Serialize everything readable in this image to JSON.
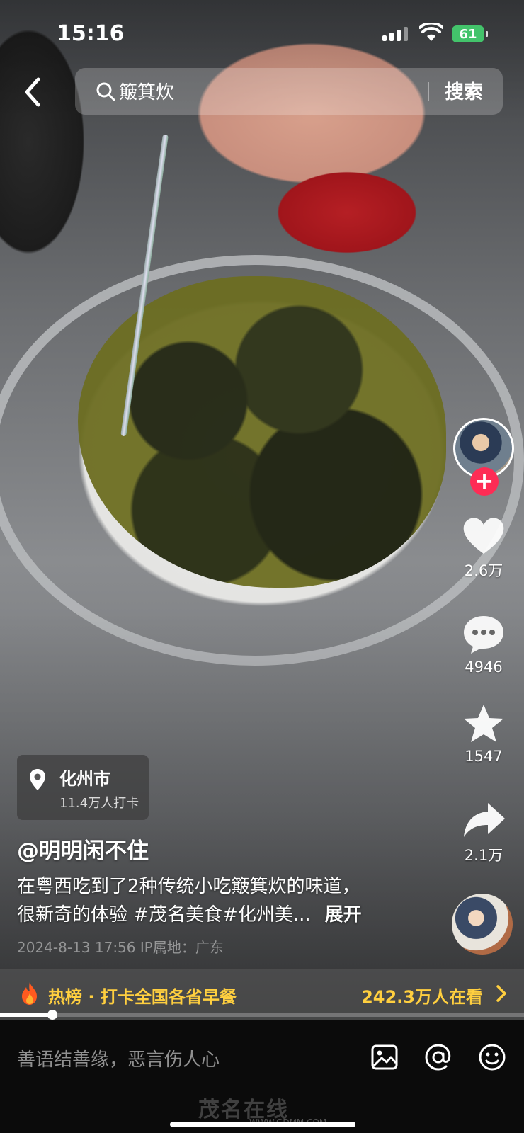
{
  "status_bar": {
    "time": "15:16",
    "battery": "61"
  },
  "search": {
    "query": "簸箕炊",
    "button_label": "搜索"
  },
  "rail": {
    "likes": "2.6万",
    "comments": "4946",
    "favorites": "1547",
    "shares": "2.1万"
  },
  "location": {
    "name": "化州市",
    "checkins": "11.4万人打卡"
  },
  "post": {
    "author": "@明明闲不住",
    "desc_line1": "在粤西吃到了2种传统小吃簸箕炊的味道，",
    "desc_line2": "很新奇的体验 #茂名美食#化州美...",
    "expand_label": "展开",
    "meta": "2024-8-13 17:56  IP属地：广东"
  },
  "hot_bar": {
    "title": "热榜 · 打卡全国各省早餐",
    "viewers": "242.3万人在看"
  },
  "progress": {
    "fraction": 0.1
  },
  "comment_bar": {
    "placeholder": "善语结善缘，恶言伤人心"
  },
  "watermark": {
    "text": "茂名在线",
    "url_text": "WWW.GDMM.COM"
  },
  "icons": [
    "chevron-left-icon",
    "search-icon",
    "location-pin-icon",
    "heart-icon",
    "comment-icon",
    "star-icon",
    "share-icon",
    "fire-icon",
    "chevron-right-icon",
    "image-icon",
    "at-icon",
    "emoji-icon"
  ],
  "colors": {
    "follow": "#fe2c55",
    "hot": "#ffcf3f",
    "battery": "#43c36b"
  }
}
